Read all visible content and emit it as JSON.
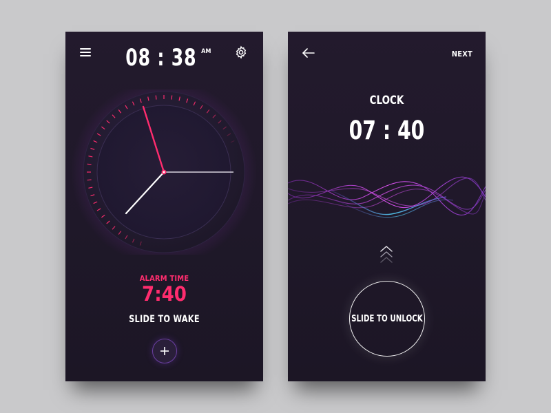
{
  "left_screen": {
    "time": "08 : 38",
    "ampm": "AM",
    "alarm_label": "ALARM TIME",
    "alarm_time": "7:40",
    "slide_label": "SLIDE TO WAKE",
    "icons": {
      "menu": "menu-icon",
      "settings": "gear-icon",
      "add": "plus-icon"
    }
  },
  "right_screen": {
    "next_label": "NEXT",
    "clock_label": "CLOCK",
    "clock_time": "07 : 40",
    "unlock_label": "SLIDE TO UNLOCK",
    "icons": {
      "back": "arrow-left-icon",
      "swipe_hint": "chevrons-up-icon"
    }
  },
  "colors": {
    "accent_pink": "#ff2c6e",
    "background_dark": "#211a2b",
    "wave_purple": "#b23be0",
    "wave_cyan": "#4fc3e8"
  }
}
